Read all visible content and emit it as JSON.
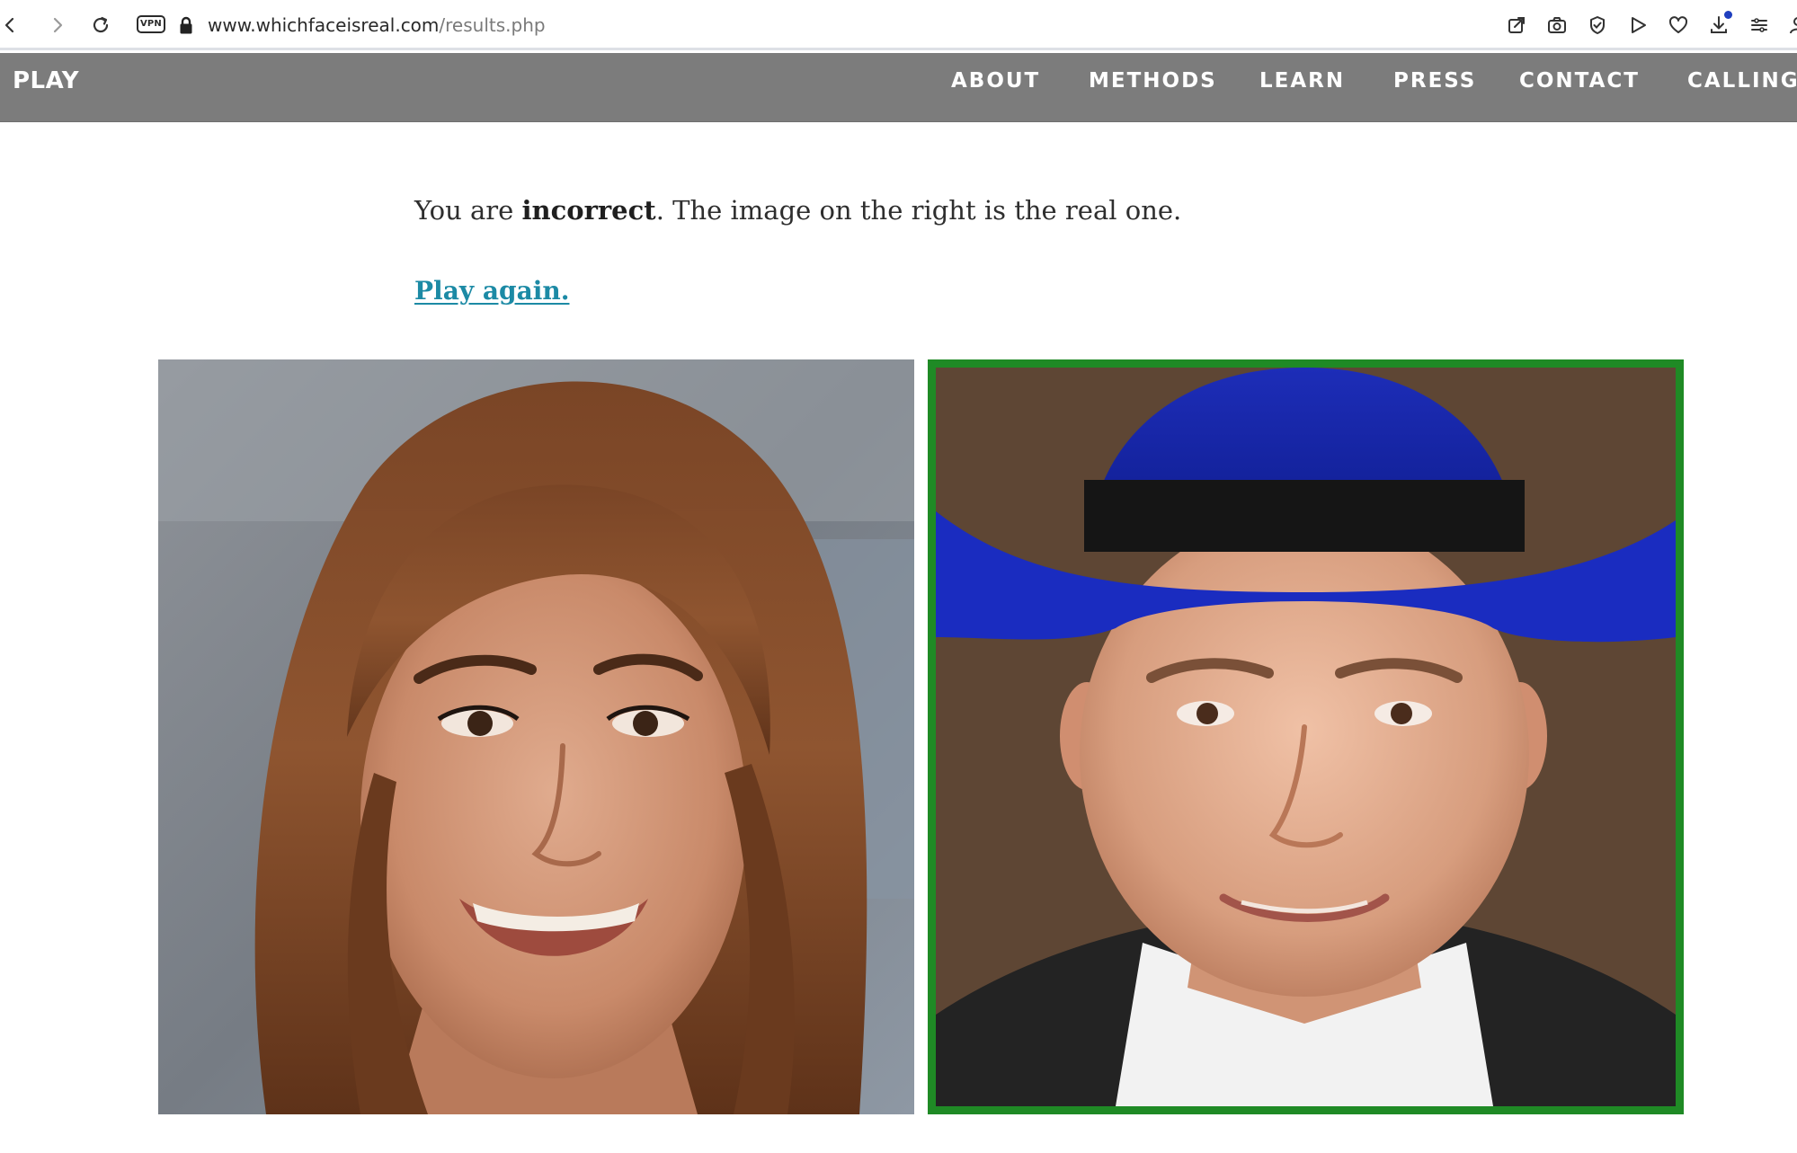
{
  "browser": {
    "vpn_label": "VPN",
    "url_domain": "www.whichfaceisreal.com",
    "url_path": "/results.php",
    "icons": [
      "back-icon",
      "forward-icon",
      "reload-icon",
      "lock-icon",
      "share-icon",
      "camera-icon",
      "shield-icon",
      "send-icon",
      "heart-icon",
      "download-icon",
      "menu-icon",
      "profile-icon"
    ]
  },
  "nav": {
    "brand": "PLAY",
    "items": [
      {
        "label": "ABOUT"
      },
      {
        "label": "METHODS"
      },
      {
        "label": "LEARN"
      },
      {
        "label": "PRESS"
      },
      {
        "label": "CONTACT"
      },
      {
        "label": "CALLING"
      }
    ]
  },
  "result": {
    "prefix": "You are ",
    "verdict": "incorrect",
    "suffix": ". The image on the right is the real one."
  },
  "play_again": "Play again.",
  "colors": {
    "nav_bg": "#7c7c7c",
    "link": "#1c8aa5",
    "real_frame": "#1f8a25"
  }
}
